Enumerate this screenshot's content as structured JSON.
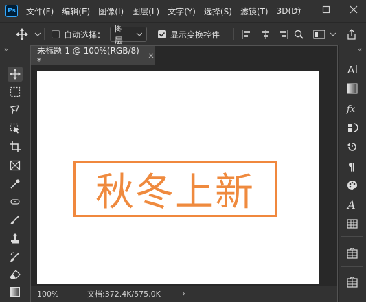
{
  "app": {
    "logo": "Ps"
  },
  "menu": [
    "文件(F)",
    "编辑(E)",
    "图像(I)",
    "图层(L)",
    "文字(Y)",
    "选择(S)",
    "滤镜(T)",
    "3D(D)"
  ],
  "options": {
    "auto_select_label": "自动选择：",
    "auto_select_checked": false,
    "layer_select_value": "图层",
    "show_transform_label": "显示变换控件",
    "show_transform_checked": true
  },
  "document": {
    "tab_title": "未标题-1 @ 100%(RGB/8) *",
    "close_glyph": "×",
    "canvas_text": "秋冬上新",
    "accent_color": "#ef8a3e"
  },
  "status": {
    "zoom": "100%",
    "doc_info": "文档:372.4K/575.0K",
    "arrow": "›"
  },
  "tools_left": [
    "move-tool",
    "marquee-tool",
    "lasso-tool",
    "object-select-tool",
    "crop-tool",
    "frame-tool",
    "eyedropper-tool",
    "healing-tool",
    "brush-tool",
    "stamp-tool",
    "history-brush-tool",
    "eraser-tool",
    "gradient-tool"
  ],
  "tools_right": [
    "character-panel",
    "gradient-panel",
    "styles-panel",
    "adjustments-panel",
    "history-panel",
    "paragraph-panel",
    "swatches-panel",
    "glyphs-panel",
    "table-panel",
    "libraries-panel",
    "layers-panel"
  ]
}
